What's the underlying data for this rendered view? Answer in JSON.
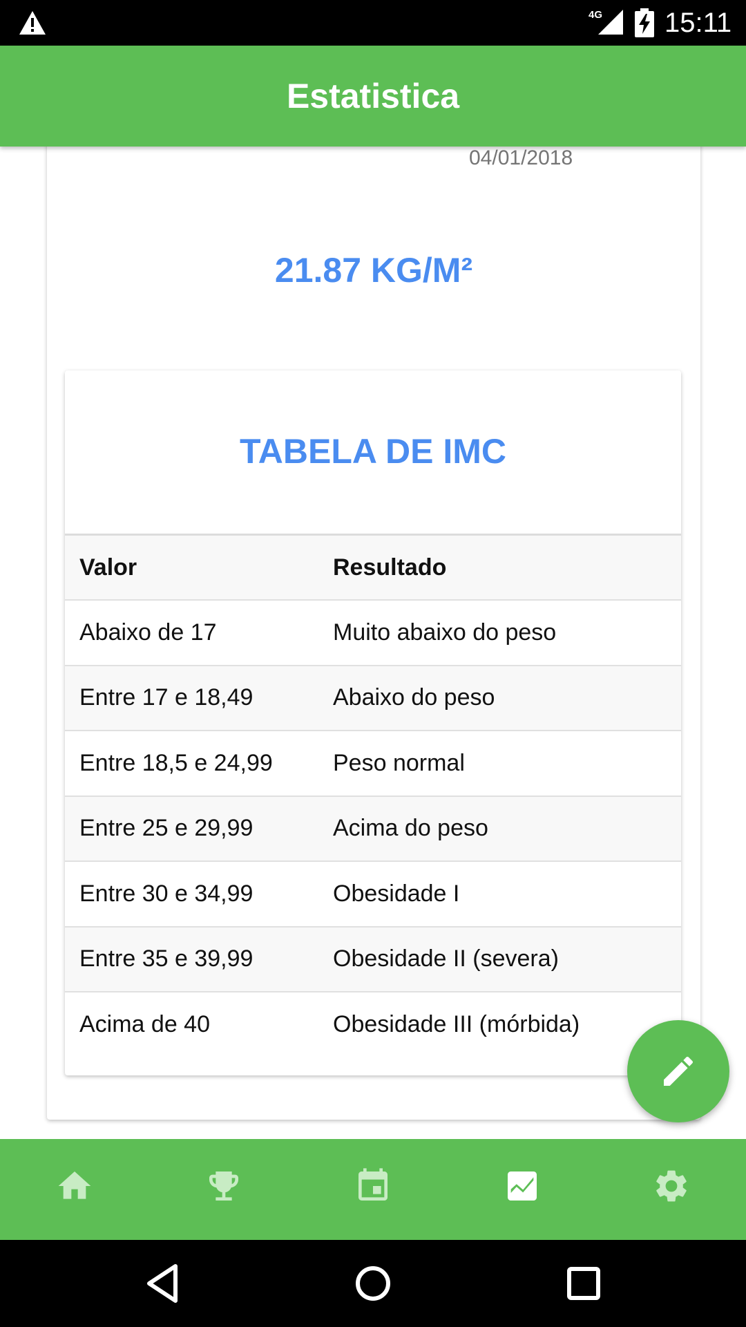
{
  "status_bar": {
    "time": "15:11",
    "network_label": "4G",
    "icons": [
      "warning-icon",
      "signal-icon",
      "battery-charging-icon"
    ]
  },
  "app_bar": {
    "title": "Estatistica"
  },
  "record": {
    "date": "04/01/2018",
    "bmi_value": "21.87 KG/M²"
  },
  "imc_table": {
    "title": "TABELA DE IMC",
    "headers": [
      "Valor",
      "Resultado"
    ],
    "rows": [
      [
        "Abaixo de 17",
        "Muito abaixo do peso"
      ],
      [
        "Entre 17 e 18,49",
        "Abaixo do peso"
      ],
      [
        "Entre 18,5 e 24,99",
        "Peso normal"
      ],
      [
        "Entre 25 e 29,99",
        "Acima do peso"
      ],
      [
        "Entre 30 e 34,99",
        "Obesidade I"
      ],
      [
        "Entre 35 e 39,99",
        "Obesidade II (severa)"
      ],
      [
        "Acima de 40",
        "Obesidade III (mórbida)"
      ]
    ]
  },
  "fab": {
    "icon": "pencil-icon"
  },
  "bottom_nav": {
    "items": [
      {
        "icon": "home-icon",
        "active": false
      },
      {
        "icon": "trophy-icon",
        "active": false
      },
      {
        "icon": "calendar-icon",
        "active": false
      },
      {
        "icon": "chart-icon",
        "active": true
      },
      {
        "icon": "gear-icon",
        "active": false
      }
    ],
    "colors": {
      "active": "#ffffff",
      "inactive": "#c8ecc4"
    }
  },
  "system_nav": {
    "icons": [
      "back-icon",
      "home-circle-icon",
      "recents-icon"
    ]
  },
  "colors": {
    "primary": "#5dbe55",
    "accent_text": "#4a8cf0",
    "muted_text": "#757575"
  }
}
